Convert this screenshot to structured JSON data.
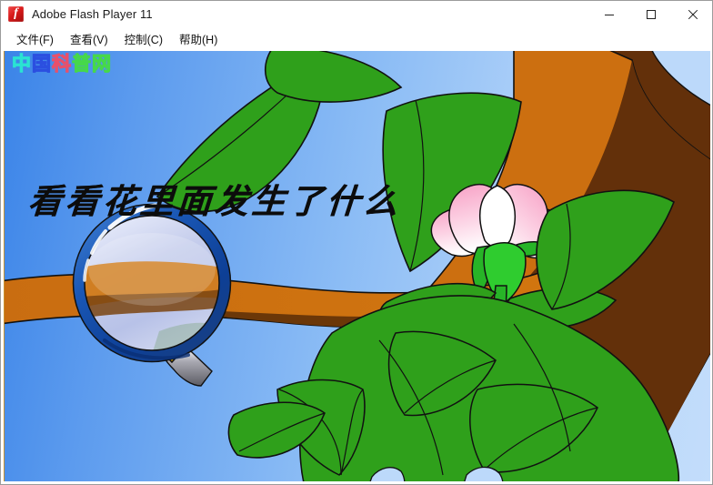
{
  "window": {
    "title": "Adobe Flash Player 11",
    "app_icon": "flash-logo-icon",
    "controls": {
      "minimize": "minimize-icon",
      "maximize": "maximize-icon",
      "close": "close-icon"
    }
  },
  "menubar": {
    "items": [
      {
        "label": "文件(F)"
      },
      {
        "label": "查看(V)"
      },
      {
        "label": "控制(C)"
      },
      {
        "label": "帮助(H)"
      }
    ]
  },
  "stage": {
    "headline": "看看花里面发生了什么",
    "watermark": {
      "chars": [
        "中",
        "国",
        "科",
        "普",
        "网"
      ],
      "colors": [
        "#2ae3d2",
        "#2b4fe0",
        "#e8506a",
        "#46d84a",
        "#46d84a"
      ]
    },
    "scene": {
      "description": "卡通插画：蓝天背景，树枝、绿叶、粉色花朵与放大镜",
      "objects": [
        {
          "name": "sky-background",
          "colors": [
            "#3b84e8",
            "#c3ddfb"
          ]
        },
        {
          "name": "tree-branch",
          "colors": [
            "#cc6f10",
            "#63300a"
          ]
        },
        {
          "name": "leaf-cluster",
          "colors": [
            "#2fa01b",
            "#1f7a12"
          ]
        },
        {
          "name": "pink-flower",
          "colors": [
            "#f49ac1",
            "#ffffff",
            "#27b427"
          ]
        },
        {
          "name": "magnifying-glass",
          "colors": [
            "#1a57b5",
            "#0b3f96",
            "#c9cfe8",
            "#f5c518",
            "#8e8e96"
          ]
        }
      ]
    }
  },
  "colors": {
    "window_bg": "#ffffff",
    "title_text": "#1b1b1b",
    "menu_text": "#111111",
    "accent_red": "#d81a1a"
  }
}
